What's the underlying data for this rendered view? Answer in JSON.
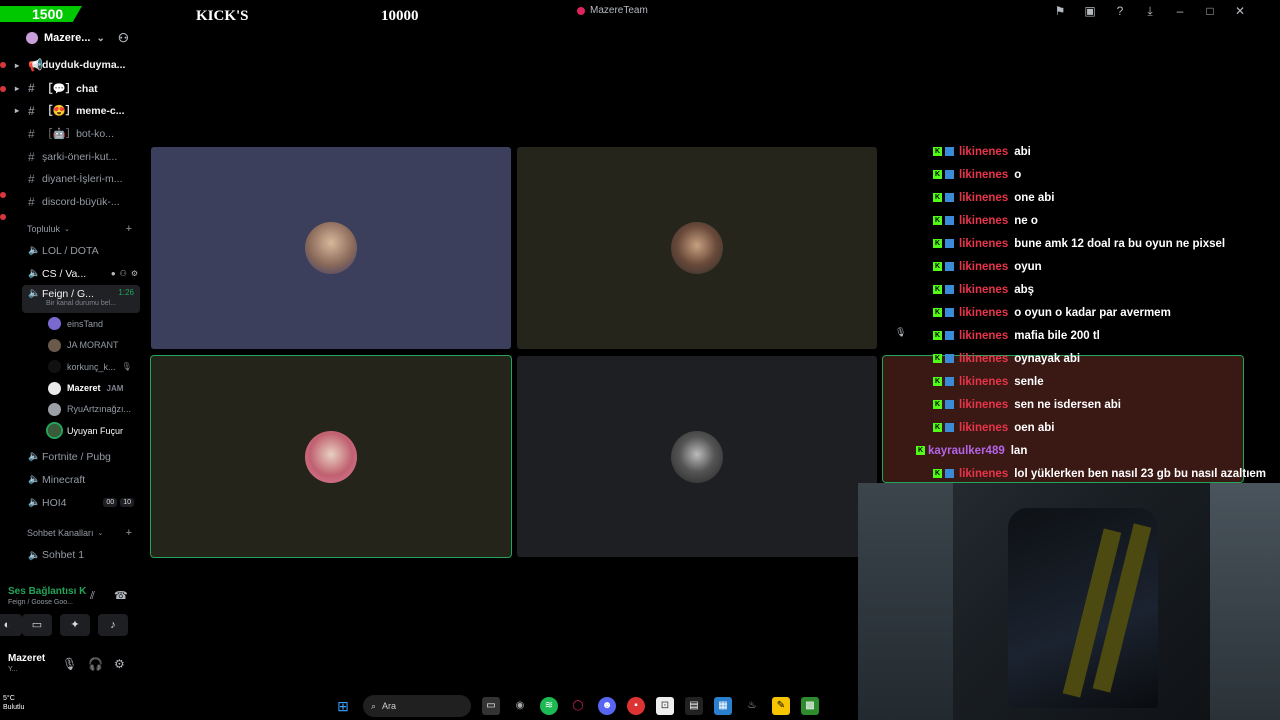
{
  "overlay": {
    "score": "1500",
    "kicks_label": "KICK'S",
    "goal": "10000"
  },
  "window": {
    "title": "MazereTeam",
    "icons": [
      "flag-icon",
      "inbox-icon",
      "help-icon",
      "download-icon",
      "minimize-icon",
      "maximize-icon",
      "close-icon"
    ]
  },
  "server": {
    "name": "Mazere...",
    "channels": [
      {
        "name": "duyduk-duyma...",
        "type": "announce",
        "bold": true
      },
      {
        "name": "［💬］chat",
        "type": "text",
        "bold": true
      },
      {
        "name": "［😍］meme-c...",
        "type": "text",
        "bold": true
      },
      {
        "name": "［🤖］bot-ko...",
        "type": "text",
        "bold": false
      },
      {
        "name": "şarki-öneri-kut...",
        "type": "text",
        "bold": false
      },
      {
        "name": "diyanet-İşleri-m...",
        "type": "text",
        "bold": false
      },
      {
        "name": "discord-büyük-...",
        "type": "text",
        "bold": false
      }
    ],
    "category_1": "Topluluk",
    "voice_channels": [
      {
        "name": "LOL / DOTA"
      },
      {
        "name": "CS / Va..."
      },
      {
        "name": "Feign / G...",
        "timer": "1:26",
        "status": "Bir kanal durumu bel..."
      }
    ],
    "members": [
      {
        "name": "einsTand"
      },
      {
        "name": "JA MORANT"
      },
      {
        "name": "korkunç_k..."
      },
      {
        "name": "Mazeret",
        "extra": "JAM"
      },
      {
        "name": "RyuArtzınağzı..."
      },
      {
        "name": "Uyuyan Fuçur"
      }
    ],
    "voice_channels_2": [
      {
        "name": "Fortnite / Pubg"
      },
      {
        "name": "Minecraft"
      },
      {
        "name": "HOI4",
        "badge_a": "00",
        "badge_b": "10"
      }
    ],
    "category_2": "Sohbet Kanalları",
    "voice_channels_3": [
      {
        "name": "Sohbet 1"
      }
    ]
  },
  "voice_panel": {
    "status": "Ses Bağlantısı K",
    "channel": "Feign / Goose Goo..."
  },
  "user_panel": {
    "name": "Mazeret",
    "status": "Y..."
  },
  "tiles": [
    {
      "bg": "#3c3f5c"
    },
    {
      "bg": "#26251c"
    },
    {
      "bg": "#25241a"
    },
    {
      "bg": "#1e1f22"
    }
  ],
  "chat": [
    {
      "user": "likinenes",
      "msg": "abi"
    },
    {
      "user": "likinenes",
      "msg": "o"
    },
    {
      "user": "likinenes",
      "msg": "one abi"
    },
    {
      "user": "likinenes",
      "msg": "ne o"
    },
    {
      "user": "likinenes",
      "msg": "bune amk 12 doal ra bu oyun ne pixsel"
    },
    {
      "user": "likinenes",
      "msg": "oyun"
    },
    {
      "user": "likinenes",
      "msg": "abş"
    },
    {
      "user": "likinenes",
      "msg": "o oyun o kadar par avermem"
    },
    {
      "user": "likinenes",
      "msg": "mafia bile 200 tl"
    },
    {
      "user": "likinenes",
      "msg": "oynayak abi"
    },
    {
      "user": "likinenes",
      "msg": "senle"
    },
    {
      "user": "likinenes",
      "msg": "sen ne isdersen abi"
    },
    {
      "user": "likinenes",
      "msg": "oen abi"
    },
    {
      "user": "kayraulker489",
      "msg": "lan"
    },
    {
      "user": "likinenes",
      "msg": "lol yüklerken ben nasıl 23 gb bu nasıl azaltıem"
    }
  ],
  "taskbar": {
    "temp": "5°C",
    "weather": "Bulutlu",
    "search_placeholder": "Ara"
  },
  "colors": {
    "accent_green": "#23a55a",
    "kick_green": "#53fc18",
    "chat_user_red": "#e8354a",
    "chat_user_purple": "#b565e8"
  }
}
